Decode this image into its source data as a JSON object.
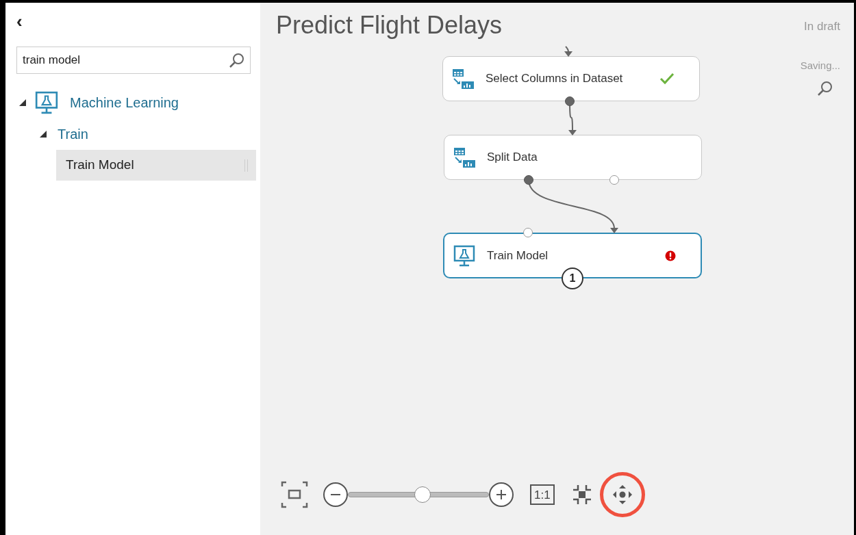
{
  "sidebar": {
    "back": "‹",
    "search": {
      "value": "train model"
    },
    "tree": [
      {
        "label": "Machine Learning",
        "kind": "category",
        "expanded": true,
        "selected": false,
        "children": [
          {
            "label": "Train",
            "kind": "group",
            "expanded": true,
            "selected": false,
            "children": [
              {
                "label": "Train Model",
                "kind": "module",
                "selected": true
              }
            ]
          }
        ]
      }
    ]
  },
  "canvas": {
    "title": "Predict Flight Delays",
    "status": "In draft",
    "save_state": "Saving...",
    "nodes": [
      {
        "label": "Select Columns in Dataset",
        "kind": "data",
        "done": true,
        "error": false,
        "selected": false,
        "inputs": [
          {
            "connected": true
          }
        ],
        "outputs": [
          {
            "connected": true
          }
        ]
      },
      {
        "label": "Split Data",
        "kind": "data",
        "done": false,
        "error": false,
        "selected": false,
        "inputs": [
          {
            "connected": true
          }
        ],
        "outputs": [
          {
            "connected": true
          },
          {
            "connected": false
          }
        ]
      },
      {
        "label": "Train Model",
        "kind": "model",
        "done": false,
        "error": true,
        "selected": true,
        "badge": "1",
        "inputs": [
          {
            "connected": false
          },
          {
            "connected": true
          }
        ]
      }
    ],
    "toolbar": {
      "zoom": {
        "level": 0.53
      },
      "actual_size": "1:1",
      "pan_highlighted": true
    }
  }
}
